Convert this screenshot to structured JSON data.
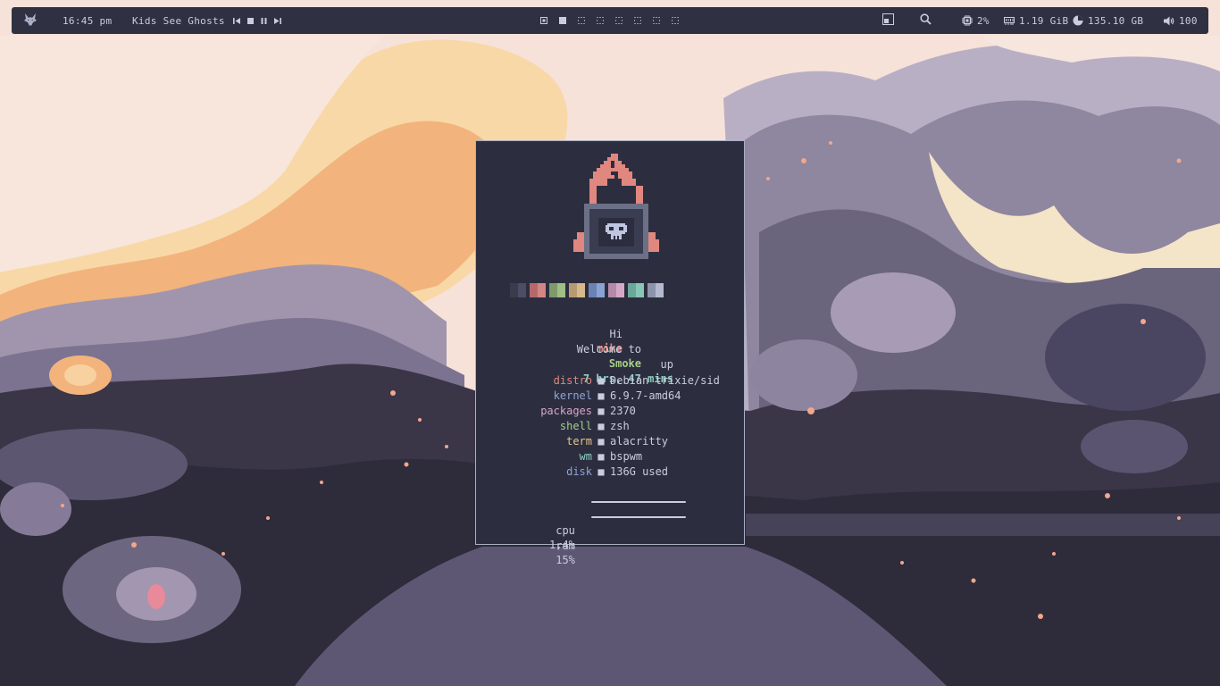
{
  "topbar": {
    "time": "16:45 pm",
    "now_playing": "Kids See Ghosts",
    "cpu": "2%",
    "memory": "1.19 GiB",
    "disk": "135.10 GB",
    "volume": "100",
    "icons": {
      "launcher": "wolf-logo-icon",
      "prev": "skip-previous-icon",
      "stop": "stop-icon",
      "pause": "pause-icon",
      "next": "skip-next-icon",
      "layout": "window-layout-icon",
      "search": "search-icon",
      "cpu": "cpu-chip-icon",
      "memory": "memory-icon",
      "disk": "pie-chart-icon",
      "volume": "speaker-icon"
    },
    "workspaces": [
      {
        "state": "occupied"
      },
      {
        "state": "focused"
      },
      {
        "state": "empty"
      },
      {
        "state": "empty"
      },
      {
        "state": "empty"
      },
      {
        "state": "empty"
      },
      {
        "state": "empty"
      },
      {
        "state": "empty"
      }
    ]
  },
  "fetch": {
    "greeting": "Hi",
    "user": "mike",
    "welcome": "Welcome to",
    "host": "Smoke",
    "up_label": "up",
    "uptime": "7 hrs, 47 mins",
    "separator": "■",
    "info": [
      {
        "key": "distro",
        "value": "Debian trixie/sid",
        "color": "#e0877f"
      },
      {
        "key": "kernel",
        "value": "6.9.7-amd64",
        "color": "#8fa3d6"
      },
      {
        "key": "packages",
        "value": "2370",
        "color": "#d9a6c6"
      },
      {
        "key": "shell",
        "value": "zsh",
        "color": "#a6cf8a"
      },
      {
        "key": "term",
        "value": "alacritty",
        "color": "#e8c48a"
      },
      {
        "key": "wm",
        "value": "bspwm",
        "color": "#8ccfc0"
      },
      {
        "key": "disk",
        "value": "136G used",
        "color": "#8fa3d6"
      }
    ],
    "cpu_label": "cpu",
    "cpu_value": "1,4%",
    "cpu_level": 0.014,
    "ram_label": "ram",
    "ram_value": "15%",
    "ram_level": 0.15,
    "palette": [
      [
        "#3a3c4e",
        "#4b4e64"
      ],
      [
        "#b56a6a",
        "#d48585"
      ],
      [
        "#7e9a6a",
        "#9fbf86"
      ],
      [
        "#b89a72",
        "#d6b98c"
      ],
      [
        "#6a82b5",
        "#8aa2d4"
      ],
      [
        "#b58aa8",
        "#d4a8c6"
      ],
      [
        "#6aa89a",
        "#88c6b8"
      ],
      [
        "#8d93ab",
        "#b4b9cf"
      ]
    ]
  },
  "colors": {
    "accent_red": "#e0877f",
    "accent_green": "#a6cf8a",
    "text": "#c9cde0",
    "bar_bg": "#2f3142",
    "window_bg": "#2c2e3f",
    "border": "#a9aec4"
  }
}
